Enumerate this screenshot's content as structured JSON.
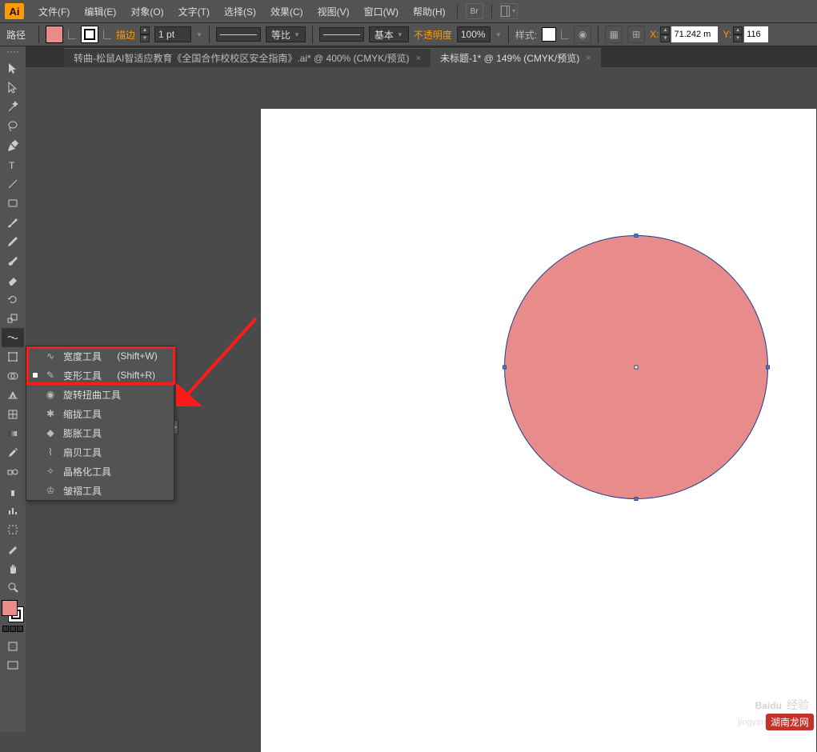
{
  "menubar": {
    "logo": "Ai",
    "items": [
      "文件(F)",
      "编辑(E)",
      "对象(O)",
      "文字(T)",
      "选择(S)",
      "效果(C)",
      "视图(V)",
      "窗口(W)",
      "帮助(H)"
    ],
    "br": "Br"
  },
  "optionbar": {
    "context_label": "路径",
    "stroke_label": "描边",
    "stroke_weight": "1 pt",
    "profile_label": "等比",
    "brush_label": "基本",
    "opacity_label": "不透明度",
    "opacity_value": "100%",
    "style_label": "样式:",
    "x_label": "X:",
    "x_value": "71.242 m",
    "y_label": "Y:",
    "y_value": "116"
  },
  "tabs": [
    {
      "label": "转曲-松鼠AI智适应教育《全国合作校校区安全指南》.ai* @ 400% (CMYK/预览)",
      "active": false
    },
    {
      "label": "未标题-1* @ 149% (CMYK/预览)",
      "active": true
    }
  ],
  "flyout": {
    "items": [
      {
        "label": "宽度工具",
        "shortcut": "(Shift+W)",
        "selected": false,
        "icon": "∿"
      },
      {
        "label": "变形工具",
        "shortcut": "(Shift+R)",
        "selected": true,
        "icon": "✎"
      },
      {
        "label": "旋转扭曲工具",
        "shortcut": "",
        "selected": false,
        "icon": "◉"
      },
      {
        "label": "缩拢工具",
        "shortcut": "",
        "selected": false,
        "icon": "✱"
      },
      {
        "label": "膨胀工具",
        "shortcut": "",
        "selected": false,
        "icon": "◆"
      },
      {
        "label": "扇贝工具",
        "shortcut": "",
        "selected": false,
        "icon": "⌇"
      },
      {
        "label": "晶格化工具",
        "shortcut": "",
        "selected": false,
        "icon": "✧"
      },
      {
        "label": "皱褶工具",
        "shortcut": "",
        "selected": false,
        "icon": "♔"
      }
    ]
  },
  "watermark": {
    "brand": "Baidu",
    "suffix": "经验",
    "url": "jingyan.baidu.com",
    "stamp": "湖南龙网"
  }
}
